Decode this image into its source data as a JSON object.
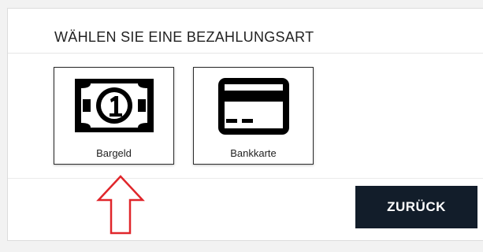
{
  "heading": "WÄHLEN SIE EINE BEZAHLUNGSART",
  "payment_options": [
    {
      "label": "Bargeld",
      "icon": "banknote-icon"
    },
    {
      "label": "Bankkarte",
      "icon": "credit-card-icon"
    }
  ],
  "back_button": {
    "label": "ZURÜCK"
  },
  "annotation": {
    "icon": "red-up-arrow-icon",
    "color": "#e0262b"
  },
  "colors": {
    "button_bg": "#121d2a",
    "icon": "#000000"
  }
}
